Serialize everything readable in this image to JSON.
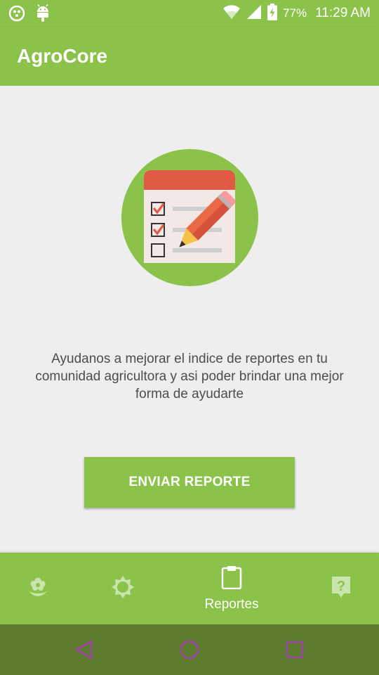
{
  "status_bar": {
    "battery_percent": "77%",
    "time": "11:29 AM",
    "icons": [
      "notification-dots-icon",
      "android-icon",
      "wifi-icon",
      "signal-icon",
      "battery-charging-icon"
    ]
  },
  "app_bar": {
    "title": "AgroCore"
  },
  "main": {
    "hero_icon": "checklist-pencil-icon",
    "message": "Ayudanos a mejorar el indice de reportes en tu comunidad agricultora y asi poder brindar una mejor forma de ayudarte",
    "send_button_label": "ENVIAR REPORTE"
  },
  "bottom_nav": {
    "items": [
      {
        "icon": "flower-icon",
        "label": "",
        "active": false
      },
      {
        "icon": "sun-icon",
        "label": "",
        "active": false
      },
      {
        "icon": "clipboard-icon",
        "label": "Reportes",
        "active": true
      },
      {
        "icon": "help-icon",
        "label": "",
        "active": false
      }
    ]
  },
  "system_nav": {
    "icons": [
      "back-icon",
      "home-icon",
      "recents-icon"
    ]
  },
  "colors": {
    "primary": "#8bc34a",
    "system_nav": "#5e7d30",
    "background": "#eeeeee",
    "hero_red": "#e05a45",
    "pencil_orange": "#ea6a47",
    "pencil_yellow": "#f5c146"
  }
}
